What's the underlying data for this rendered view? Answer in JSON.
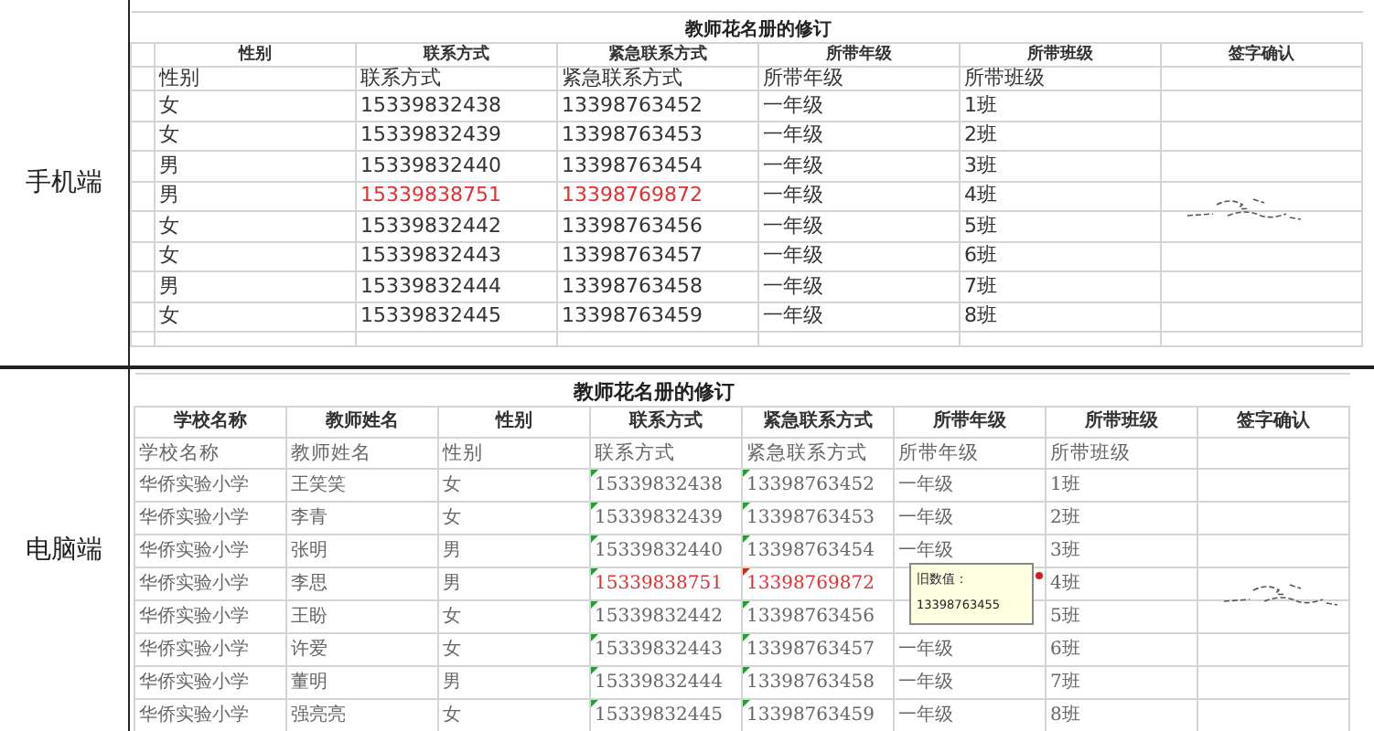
{
  "sections": [
    {
      "kind": "mobile",
      "label": "手机端",
      "title": "教师花名册的修订",
      "headings": [
        {
          "text": "性别",
          "kind": "text"
        },
        {
          "text": "联系方式",
          "kind": "contact"
        },
        {
          "text": "紧急联系方式",
          "kind": "contact"
        },
        {
          "text": "所带年级",
          "kind": "text"
        },
        {
          "text": "所带班级",
          "kind": "text"
        },
        {
          "text": "签字确认",
          "kind": "signature"
        }
      ],
      "subheadings": [
        "性别",
        "联系方式",
        "紧急联系方式",
        "所带年级",
        "所带班级"
      ],
      "rows": [
        {
          "cells": [
            "女",
            "15339832438",
            "13398763452",
            "一年级",
            "1班"
          ],
          "changed": false,
          "signed": false
        },
        {
          "cells": [
            "女",
            "15339832439",
            "13398763453",
            "一年级",
            "2班"
          ],
          "changed": false,
          "signed": false
        },
        {
          "cells": [
            "男",
            "15339832440",
            "13398763454",
            "一年级",
            "3班"
          ],
          "changed": false,
          "signed": false
        },
        {
          "cells": [
            "男",
            "15339838751",
            "13398769872",
            "一年级",
            "4班"
          ],
          "changed": true,
          "signed": true
        },
        {
          "cells": [
            "女",
            "15339832442",
            "13398763456",
            "一年级",
            "5班"
          ],
          "changed": false,
          "signed": false
        },
        {
          "cells": [
            "女",
            "15339832443",
            "13398763457",
            "一年级",
            "6班"
          ],
          "changed": false,
          "signed": false
        },
        {
          "cells": [
            "男",
            "15339832444",
            "13398763458",
            "一年级",
            "7班"
          ],
          "changed": false,
          "signed": false
        },
        {
          "cells": [
            "女",
            "15339832445",
            "13398763459",
            "一年级",
            "8班"
          ],
          "changed": false,
          "signed": false
        }
      ]
    },
    {
      "kind": "desktop",
      "label": "电脑端",
      "title": "教师花名册的修订",
      "headings": [
        {
          "text": "学校名称",
          "kind": "text"
        },
        {
          "text": "教师姓名",
          "kind": "text"
        },
        {
          "text": "性别",
          "kind": "text"
        },
        {
          "text": "联系方式",
          "kind": "contact"
        },
        {
          "text": "紧急联系方式",
          "kind": "contact"
        },
        {
          "text": "所带年级",
          "kind": "text"
        },
        {
          "text": "所带班级",
          "kind": "text"
        },
        {
          "text": "签字确认",
          "kind": "signature"
        }
      ],
      "subheadings": [
        "学校名称",
        "教师姓名",
        "性别",
        "联系方式",
        "紧急联系方式",
        "所带年级",
        "所带班级"
      ],
      "rows": [
        {
          "cells": [
            "华侨实验小学",
            "王笑笑",
            "女",
            "15339832438",
            "13398763452",
            "一年级",
            "1班"
          ],
          "changed": false,
          "signed": false
        },
        {
          "cells": [
            "华侨实验小学",
            "李青",
            "女",
            "15339832439",
            "13398763453",
            "一年级",
            "2班"
          ],
          "changed": false,
          "signed": false
        },
        {
          "cells": [
            "华侨实验小学",
            "张明",
            "男",
            "15339832440",
            "13398763454",
            "一年级",
            "3班"
          ],
          "changed": false,
          "signed": false
        },
        {
          "cells": [
            "华侨实验小学",
            "李思",
            "男",
            "15339838751",
            "13398769872",
            null,
            "4班"
          ],
          "changed": true,
          "signed": true,
          "comment": {
            "title": "旧数值：",
            "value": "13398763455"
          }
        },
        {
          "cells": [
            "华侨实验小学",
            "王盼",
            "女",
            "15339832442",
            "13398763456",
            null,
            "5班"
          ],
          "changed": false,
          "signed": false
        },
        {
          "cells": [
            "华侨实验小学",
            "许爱",
            "女",
            "15339832443",
            "13398763457",
            "一年级",
            "6班"
          ],
          "changed": false,
          "signed": false
        },
        {
          "cells": [
            "华侨实验小学",
            "董明",
            "男",
            "15339832444",
            "13398763458",
            "一年级",
            "7班"
          ],
          "changed": false,
          "signed": false
        },
        {
          "cells": [
            "华侨实验小学",
            "强亮亮",
            "女",
            "15339832445",
            "13398763459",
            "一年级",
            "8班"
          ],
          "changed": false,
          "signed": false
        }
      ]
    }
  ]
}
